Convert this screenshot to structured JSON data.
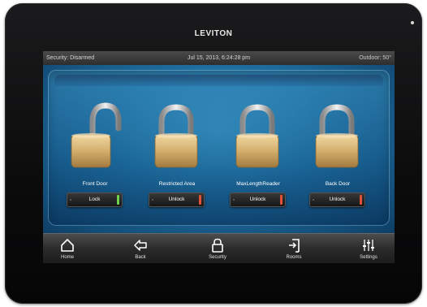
{
  "device": {
    "brand": "LEVITON"
  },
  "status_bar": {
    "security": "Security: Disarmed",
    "datetime": "Jul 15, 2013, 6:24:28 pm",
    "outdoor": "Outdoor: 50°"
  },
  "locks": [
    {
      "name": "Front Door",
      "button": "Lock",
      "state": "unlocked",
      "indicator_color": "#6fd24a"
    },
    {
      "name": "Restricted Area",
      "button": "Unlock",
      "state": "locked",
      "indicator_color": "#e0503a"
    },
    {
      "name": "MaxLengthReader",
      "button": "Unlock",
      "state": "locked",
      "indicator_color": "#e0503a"
    },
    {
      "name": "Back Door",
      "button": "Unlock",
      "state": "locked",
      "indicator_color": "#e0503a"
    }
  ],
  "nav": [
    {
      "label": "Home",
      "icon": "home-icon"
    },
    {
      "label": "Back",
      "icon": "back-arrow-icon"
    },
    {
      "label": "Security",
      "icon": "padlock-icon"
    },
    {
      "label": "Rooms",
      "icon": "door-icon"
    },
    {
      "label": "Settings",
      "icon": "sliders-icon"
    }
  ]
}
